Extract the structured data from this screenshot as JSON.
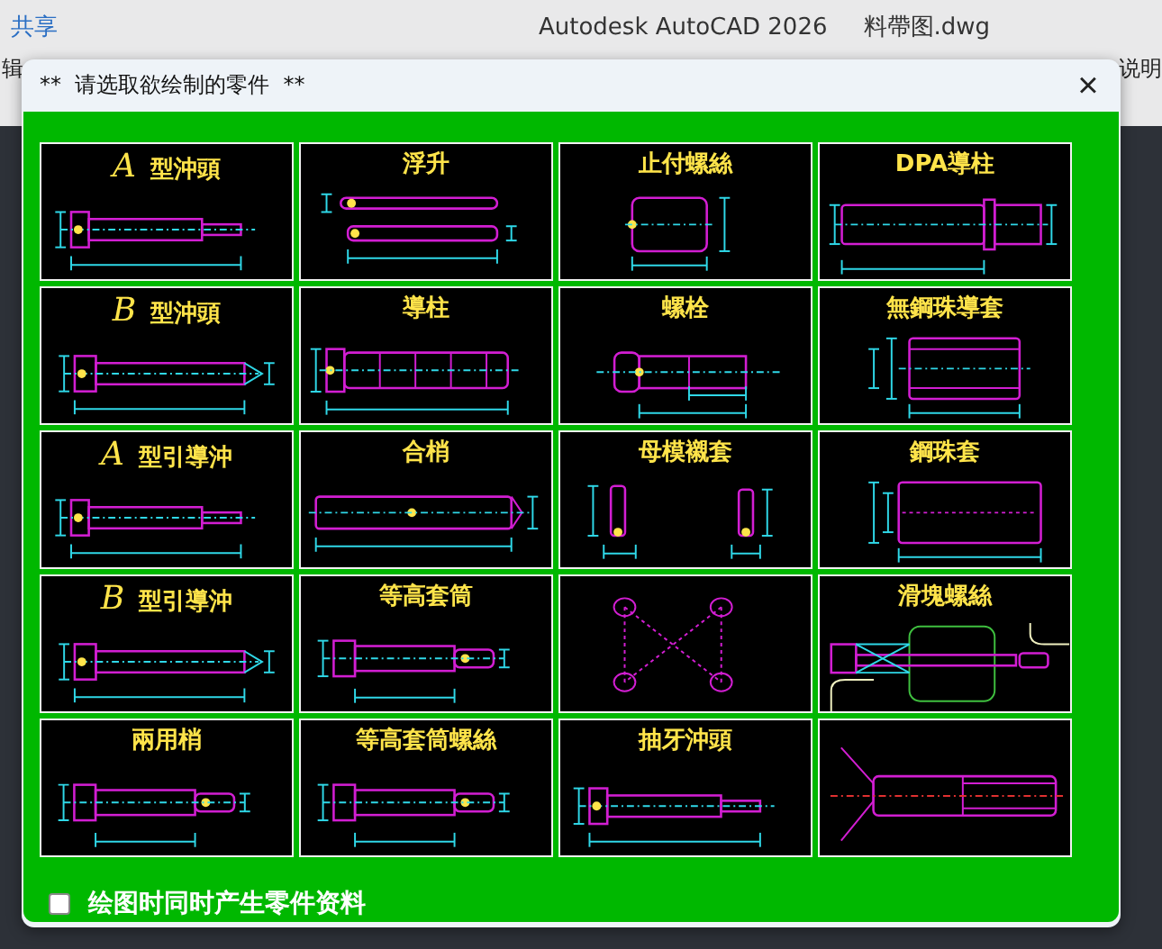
{
  "app_window": {
    "share_button": "共享",
    "title": "Autodesk AutoCAD 2026",
    "document": "料帶图.dwg",
    "menu_left": "辑",
    "menu_right": "说明"
  },
  "dialog": {
    "title": "**  请选取欲绘制的零件  **",
    "close": "×",
    "parts": [
      {
        "kind": "punch",
        "letter": "A",
        "title": "型沖頭"
      },
      {
        "kind": "twin-pin",
        "title": "浮升"
      },
      {
        "kind": "block",
        "title": "止付螺絲"
      },
      {
        "kind": "stepped-post",
        "title": "DPA導柱"
      },
      {
        "kind": "plain-punch",
        "letter": "B",
        "title": "型沖頭"
      },
      {
        "kind": "segmented-post",
        "title": "導柱"
      },
      {
        "kind": "bolt",
        "title": "螺栓"
      },
      {
        "kind": "sleeve",
        "title": "無鋼珠導套"
      },
      {
        "kind": "punch",
        "letter": "A",
        "title": "型引導沖"
      },
      {
        "kind": "dowel",
        "title": "合梢"
      },
      {
        "kind": "twin-bushing",
        "title": "母模襯套"
      },
      {
        "kind": "ball-sleeve",
        "title": "鋼珠套"
      },
      {
        "kind": "plain-punch",
        "letter": "B",
        "title": "型引導沖"
      },
      {
        "kind": "shoulder",
        "title": "等高套筒"
      },
      {
        "kind": "cross"
      },
      {
        "kind": "slider",
        "title": "滑塊螺絲"
      },
      {
        "kind": "shoulder",
        "title": "兩用梢"
      },
      {
        "kind": "shoulder",
        "title": "等高套筒螺絲"
      },
      {
        "kind": "punch",
        "title": "抽牙沖頭"
      },
      {
        "kind": "countersunk"
      }
    ],
    "option": {
      "label": "绘图时同时产生零件资料",
      "checked": false
    }
  }
}
